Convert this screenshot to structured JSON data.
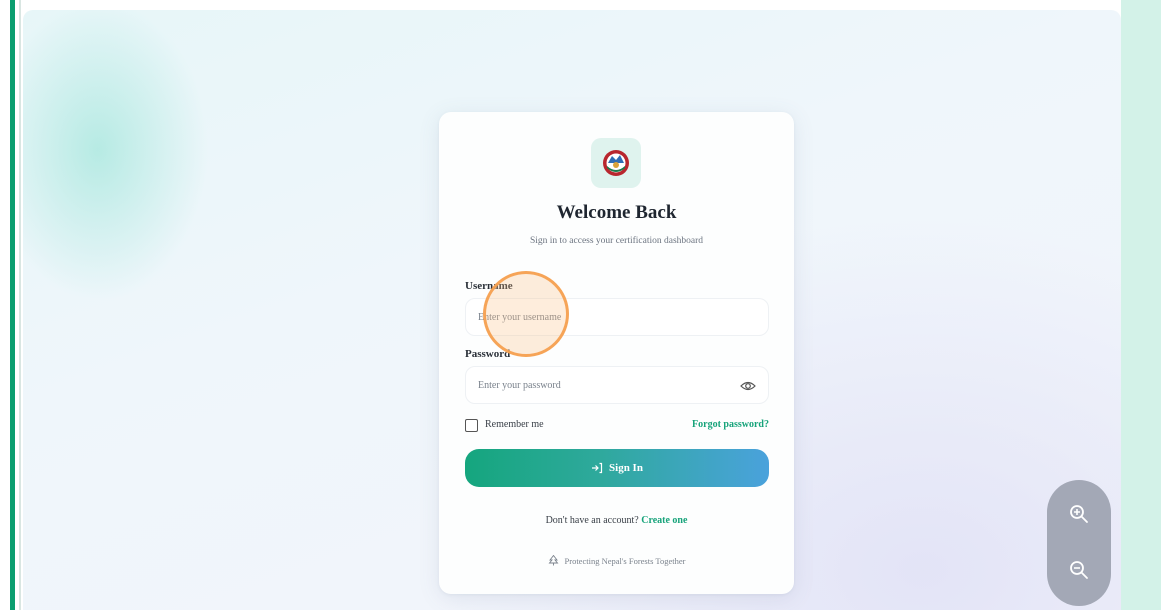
{
  "login": {
    "title": "Welcome Back",
    "subtitle": "Sign in to access your certification dashboard",
    "username": {
      "label": "Username",
      "placeholder": "Enter your username"
    },
    "password": {
      "label": "Password",
      "placeholder": "Enter your password"
    },
    "remember_label": "Remember me",
    "forgot_label": "Forgot password?",
    "signin_label": "Sign In",
    "no_account_text": "Don't have an account?",
    "create_label": "Create one",
    "footer_text": "Protecting Nepal's Forests Together"
  },
  "icons": {
    "logo": "nepal-emblem-icon",
    "eye": "eye-icon",
    "signin": "login-arrow-icon",
    "footer": "tree-icon",
    "zoom_in": "zoom-in-icon",
    "zoom_out": "zoom-out-icon"
  },
  "colors": {
    "accent": "#16a37a",
    "button_gradient_start": "#15a67e",
    "button_gradient_end": "#4aa2dc",
    "zoom_panel": "#a3a8b6",
    "left_bar": "#0b9e6f"
  }
}
